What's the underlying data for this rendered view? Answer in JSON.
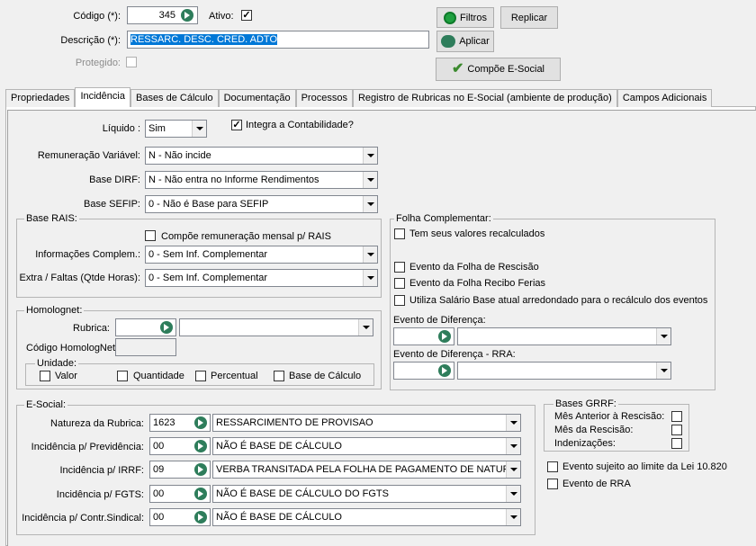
{
  "header": {
    "codigo_label": "Código (*):",
    "codigo_value": "345",
    "ativo_label": "Ativo:",
    "ativo_checked": true,
    "descricao_label": "Descrição (*):",
    "descricao_value": "RESSARC. DESC. CRED. ADTO",
    "protegido_label": "Protegido:",
    "filtros_label": "Filtros",
    "replicar_label": "Replicar",
    "aplicar_label": "Aplicar",
    "compoe_label": "Compõe E-Social"
  },
  "tabs": [
    "Propriedades",
    "Incidência",
    "Bases de Cálculo",
    "Documentação",
    "Processos",
    "Registro de Rubricas no E-Social (ambiente de produção)",
    "Campos Adicionais"
  ],
  "active_tab": "Incidência",
  "main": {
    "liquido_label": "Líquido :",
    "liquido_value": "Sim",
    "integra_label": "Integra a Contabilidade?",
    "integra_checked": true,
    "remun_label": "Remuneração Variável:",
    "remun_value": "N - Não incide",
    "dirf_label": "Base DIRF:",
    "dirf_value": "N - Não entra no Informe Rendimentos",
    "sefip_label": "Base SEFIP:",
    "sefip_value": "0 - Não é Base para SEFIP"
  },
  "rais": {
    "title": "Base RAIS:",
    "compoe_label": "Compõe remuneração mensal p/ RAIS",
    "info_label": "Informações Complem.:",
    "info_value": "0 - Sem Inf. Complementar",
    "extra_label": "Extra / Faltas (Qtde Horas):",
    "extra_value": "0 - Sem Inf. Complementar"
  },
  "homolognet": {
    "title": "Homolognet:",
    "rubrica_label": "Rubrica:",
    "codigo_label": "Código HomologNet",
    "unidade_label": "Unidade:",
    "valor_label": "Valor",
    "quantidade_label": "Quantidade",
    "percentual_label": "Percentual",
    "base_label": "Base de Cálculo"
  },
  "folha": {
    "title": "Folha Complementar:",
    "recalc_label": "Tem seus valores recalculados",
    "rescisao_label": "Evento da Folha de Rescisão",
    "ferias_label": "Evento da Folha Recibo Ferias",
    "salario_label": "Utiliza Salário Base atual arredondado para o recálculo dos eventos",
    "diferenca_label": "Evento de Diferença:",
    "diferenca_rra_label": "Evento de Diferença - RRA:"
  },
  "esocial": {
    "title": "E-Social:",
    "natureza_label": "Natureza da Rubrica:",
    "natureza_code": "1623",
    "natureza_value": "RESSARCIMENTO DE PROVISAO",
    "prev_label": "Incidência p/ Previdência:",
    "prev_code": "00",
    "prev_value": "NÃO É BASE DE CÁLCULO",
    "irrf_label": "Incidência p/ IRRF:",
    "irrf_code": "09",
    "irrf_value": "VERBA TRANSITADA PELA FOLHA DE PAGAMENTO DE NATUREZ",
    "fgts_label": "Incidência p/ FGTS:",
    "fgts_code": "00",
    "fgts_value": "NÃO É BASE DE CÁLCULO DO FGTS",
    "sind_label": "Incidência p/ Contr.Sindical:",
    "sind_code": "00",
    "sind_value": "NÃO É BASE DE CÁLCULO"
  },
  "grrf": {
    "title": "Bases GRRF:",
    "mes_anterior_label": "Mês Anterior à Rescisão:",
    "mes_rescisao_label": "Mês da Rescisão:",
    "indenizacoes_label": "Indenizações:"
  },
  "lei_label": "Evento sujeito ao limite da Lei 10.820",
  "rra_label": "Evento de RRA",
  "colors": {
    "selection": "#0078d7",
    "icon_green": "#2e7d5b"
  }
}
